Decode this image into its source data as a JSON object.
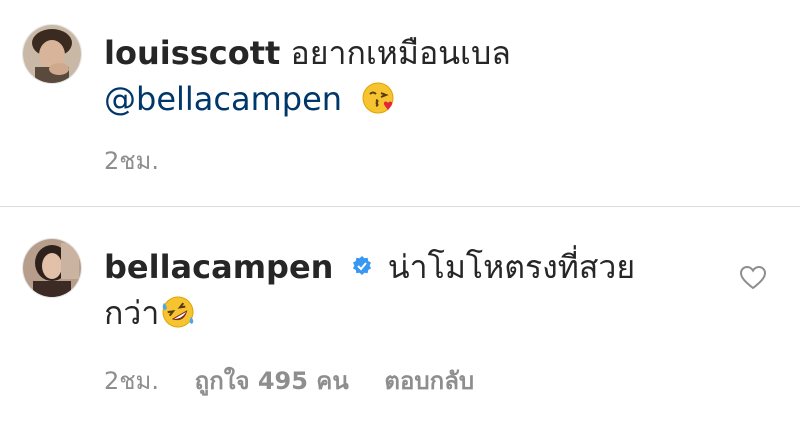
{
  "comments": [
    {
      "username": "louisscott",
      "text_line1": "อยากเหมือนเบล",
      "mention": "@bellacampen",
      "emoji": "kissing-face-with-heart-emoji",
      "time": "2ชม."
    },
    {
      "username": "bellacampen",
      "verified": true,
      "text_line1": "น่าโมโหตรงที่สวย",
      "text_line2": "กว่า",
      "emoji": "rolling-on-the-floor-laughing-emoji",
      "time": "2ชม.",
      "likes": "ถูกใจ 495 คน",
      "reply": "ตอบกลับ"
    }
  ],
  "colors": {
    "text": "#262626",
    "mention": "#00376b",
    "meta": "#8e8e8e",
    "verified": "#3897f0",
    "divider": "#dbdbdb"
  }
}
